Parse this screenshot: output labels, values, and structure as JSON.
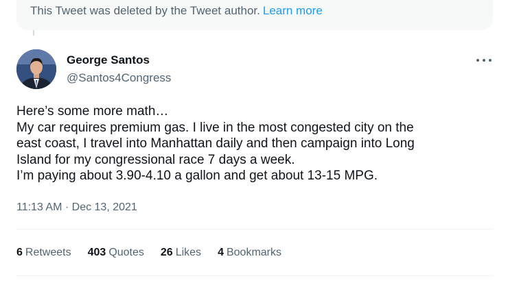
{
  "deleted_notice": {
    "text": "This Tweet was deleted by the Tweet author.",
    "link": "Learn more"
  },
  "author": {
    "name": "George Santos",
    "handle": "@Santos4Congress"
  },
  "tweet": {
    "lines": [
      "Here’s some more math…",
      "My car requires premium gas. I live in the most congested city on the",
      "east coast, I travel into Manhattan daily and then campaign into Long",
      "Island for my congressional race 7 days a week.",
      "I’m paying about 3.90-4.10 a gallon and get about 13-15 MPG."
    ],
    "timestamp": "11:13 AM · Dec 13, 2021"
  },
  "stats": {
    "retweets": {
      "count": "6",
      "label": "Retweets"
    },
    "quotes": {
      "count": "403",
      "label": "Quotes"
    },
    "likes": {
      "count": "26",
      "label": "Likes"
    },
    "bookmarks": {
      "count": "4",
      "label": "Bookmarks"
    }
  },
  "colors": {
    "accent": "#1d9bf0",
    "secondary_text": "#536471",
    "primary_text": "#0f1419"
  },
  "icons": [
    "more-icon"
  ]
}
